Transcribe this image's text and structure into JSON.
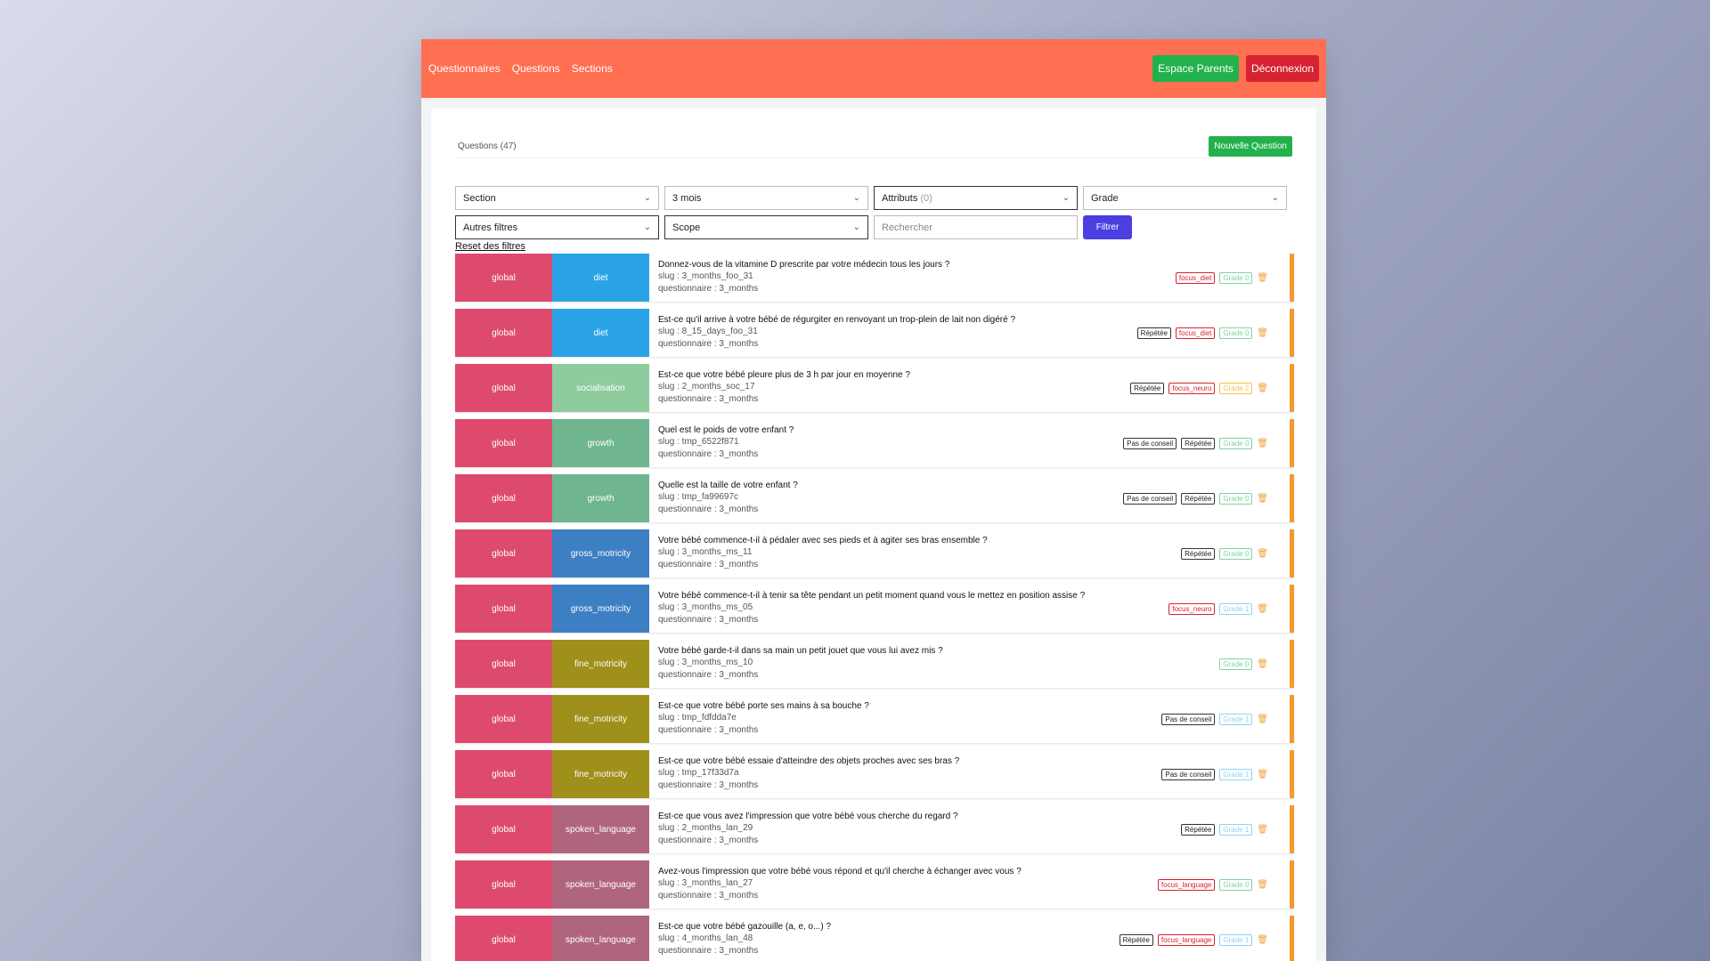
{
  "nav": {
    "links": [
      "Questionnaires",
      "Questions",
      "Sections"
    ],
    "parents_label": "Espace Parents",
    "logout_label": "Déconnexion"
  },
  "header": {
    "count_label": "Questions (47)",
    "new_button": "Nouvelle Question"
  },
  "filters": {
    "section": "Section",
    "age": "3 mois",
    "attributes": "Attributs",
    "attributes_count": "(0)",
    "grade": "Grade",
    "other": "Autres filtres",
    "scope": "Scope",
    "search_placeholder": "Rechercher",
    "filter_button": "Filtrer",
    "reset": "Reset des filtres"
  },
  "colors": {
    "navbar": "#ff6f52",
    "scope_global": "#de4a6e",
    "diet": "#2aa3e6",
    "socialisation": "#8fcc9d",
    "growth": "#6fb590",
    "gross_motricity": "#3d7fc3",
    "fine_motricity": "#9f8f1b",
    "spoken_language": "#b0657e"
  },
  "questions": [
    {
      "scope": "global",
      "section": "diet",
      "title": "Donnez-vous de la vitamine D prescrite par votre médecin tous les jours ?",
      "slug": "slug : 3_months_foo_31",
      "questionnaire": "questionnaire : 3_months",
      "tags": [
        {
          "label": "focus_diet",
          "kind": "focus"
        },
        {
          "label": "Grade 0",
          "kind": "g0"
        }
      ]
    },
    {
      "scope": "global",
      "section": "diet",
      "title": "Est-ce qu'il arrive à votre bébé de régurgiter en renvoyant un trop-plein de lait non digéré ?",
      "slug": "slug : 8_15_days_foo_31",
      "questionnaire": "questionnaire : 3_months",
      "tags": [
        {
          "label": "Répétée",
          "kind": "rep"
        },
        {
          "label": "focus_diet",
          "kind": "focus"
        },
        {
          "label": "Grade 0",
          "kind": "g0"
        }
      ]
    },
    {
      "scope": "global",
      "section": "socialisation",
      "title": "Est-ce que votre bébé pleure plus de 3 h par jour en moyenne ?",
      "slug": "slug : 2_months_soc_17",
      "questionnaire": "questionnaire : 3_months",
      "tags": [
        {
          "label": "Répétée",
          "kind": "rep"
        },
        {
          "label": "focus_neuro",
          "kind": "focus"
        },
        {
          "label": "Grade 2",
          "kind": "g2"
        }
      ]
    },
    {
      "scope": "global",
      "section": "growth",
      "title": "Quel est le poids de votre enfant ?",
      "slug": "slug : tmp_6522f871",
      "questionnaire": "questionnaire : 3_months",
      "tags": [
        {
          "label": "Pas de conseil",
          "kind": "rep"
        },
        {
          "label": "Répétée",
          "kind": "rep"
        },
        {
          "label": "Grade 0",
          "kind": "g0"
        }
      ]
    },
    {
      "scope": "global",
      "section": "growth",
      "title": "Quelle est la taille de votre enfant ?",
      "slug": "slug : tmp_fa99697c",
      "questionnaire": "questionnaire : 3_months",
      "tags": [
        {
          "label": "Pas de conseil",
          "kind": "rep"
        },
        {
          "label": "Répétée",
          "kind": "rep"
        },
        {
          "label": "Grade 0",
          "kind": "g0"
        }
      ]
    },
    {
      "scope": "global",
      "section": "gross_motricity",
      "title": "Votre bébé commence-t-il à pédaler avec ses pieds et à agiter ses bras ensemble ?",
      "slug": "slug : 3_months_ms_11",
      "questionnaire": "questionnaire : 3_months",
      "tags": [
        {
          "label": "Répétée",
          "kind": "rep"
        },
        {
          "label": "Grade 0",
          "kind": "g0"
        }
      ]
    },
    {
      "scope": "global",
      "section": "gross_motricity",
      "title": "Votre bébé commence-t-il à tenir sa tête pendant un petit moment quand vous le mettez en position assise ?",
      "slug": "slug : 3_months_ms_05",
      "questionnaire": "questionnaire : 3_months",
      "tags": [
        {
          "label": "focus_neuro",
          "kind": "focus"
        },
        {
          "label": "Grade 1",
          "kind": "g1"
        }
      ]
    },
    {
      "scope": "global",
      "section": "fine_motricity",
      "title": "Votre bébé garde-t-il dans sa main un petit jouet que vous lui avez mis ?",
      "slug": "slug : 3_months_ms_10",
      "questionnaire": "questionnaire : 3_months",
      "tags": [
        {
          "label": "Grade 0",
          "kind": "g0"
        }
      ]
    },
    {
      "scope": "global",
      "section": "fine_motricity",
      "title": "Est-ce que votre bébé porte ses mains à sa bouche ?",
      "slug": "slug : tmp_fdfdda7e",
      "questionnaire": "questionnaire : 3_months",
      "tags": [
        {
          "label": "Pas de conseil",
          "kind": "rep"
        },
        {
          "label": "Grade 1",
          "kind": "g1"
        }
      ]
    },
    {
      "scope": "global",
      "section": "fine_motricity",
      "title": "Est-ce que votre bébé essaie d'atteindre des objets proches avec ses bras ?",
      "slug": "slug : tmp_17f33d7a",
      "questionnaire": "questionnaire : 3_months",
      "tags": [
        {
          "label": "Pas de conseil",
          "kind": "rep"
        },
        {
          "label": "Grade 1",
          "kind": "g1"
        }
      ]
    },
    {
      "scope": "global",
      "section": "spoken_language",
      "title": "Est-ce que vous avez l'impression que votre bébé vous cherche du regard ?",
      "slug": "slug : 2_months_lan_29",
      "questionnaire": "questionnaire : 3_months",
      "tags": [
        {
          "label": "Répétée",
          "kind": "rep"
        },
        {
          "label": "Grade 1",
          "kind": "g1"
        }
      ]
    },
    {
      "scope": "global",
      "section": "spoken_language",
      "title": "Avez-vous l'impression que votre bébé vous répond et qu'il cherche à échanger avec vous ?",
      "slug": "slug : 3_months_lan_27",
      "questionnaire": "questionnaire : 3_months",
      "tags": [
        {
          "label": "focus_language",
          "kind": "focus"
        },
        {
          "label": "Grade 0",
          "kind": "g0"
        }
      ]
    },
    {
      "scope": "global",
      "section": "spoken_language",
      "title": "Est-ce que votre bébé gazouille (a, e, o...) ?",
      "slug": "slug : 4_months_lan_48",
      "questionnaire": "questionnaire : 3_months",
      "tags": [
        {
          "label": "Répétée",
          "kind": "rep"
        },
        {
          "label": "focus_language",
          "kind": "focus"
        },
        {
          "label": "Grade 1",
          "kind": "g1"
        }
      ]
    }
  ]
}
